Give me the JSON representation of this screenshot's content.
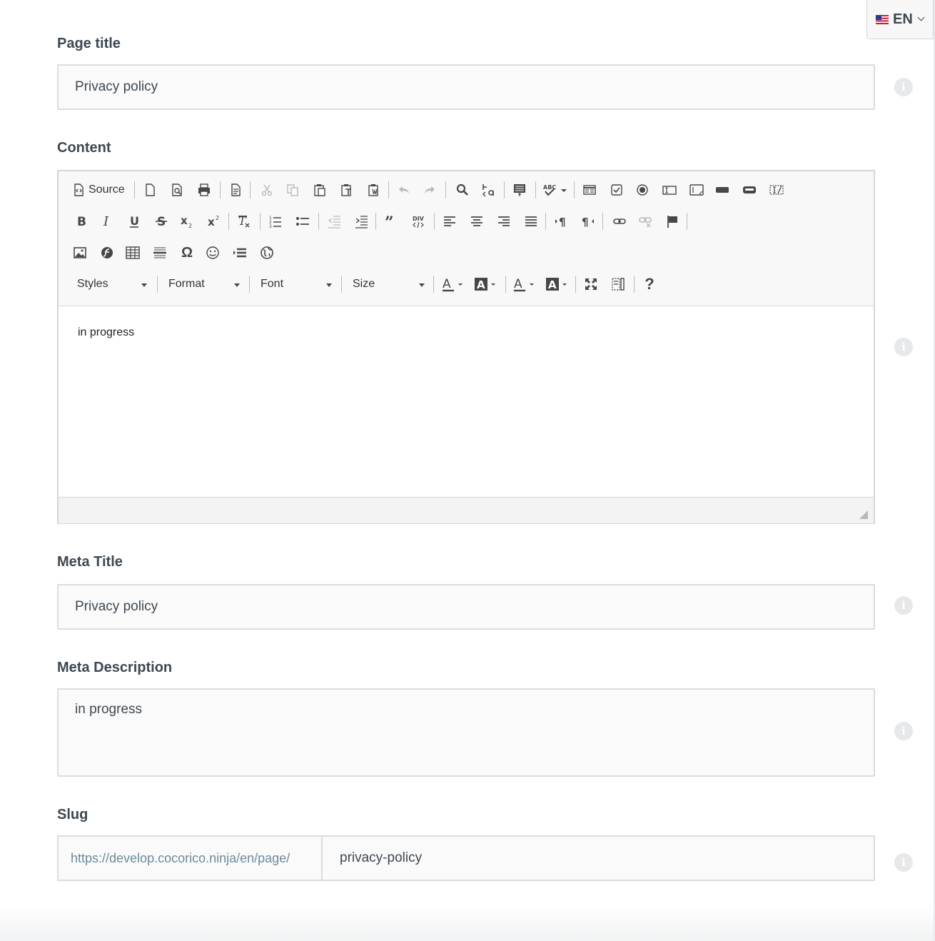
{
  "language": {
    "code": "EN",
    "flag_icon": "us-flag-icon"
  },
  "fields": {
    "page_title": {
      "label": "Page title",
      "value": "Privacy policy"
    },
    "content": {
      "label": "Content",
      "value": "in progress"
    },
    "meta_title": {
      "label": "Meta Title",
      "value": "Privacy policy"
    },
    "meta_description": {
      "label": "Meta Description",
      "value": "in progress"
    },
    "slug": {
      "label": "Slug",
      "prefix": "https://develop.cocorico.ninja/en/page/",
      "value": "privacy-policy"
    }
  },
  "editor": {
    "source_label": "Source",
    "combos": {
      "styles": "Styles",
      "format": "Format",
      "font": "Font",
      "size": "Size"
    },
    "help_label": "?",
    "omega_label": "Ω"
  },
  "info_glyph": "i",
  "colors": {
    "text": "#3d4852",
    "border": "#dadcde",
    "field_bg": "#fafafa",
    "info_bg": "#e7e8e9",
    "slug_prefix": "#6c8a9e"
  }
}
